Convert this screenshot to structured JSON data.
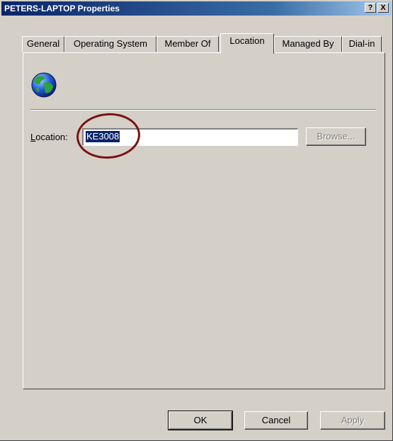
{
  "window": {
    "title": "PETERS-LAPTOP Properties",
    "help_label": "?",
    "close_label": "X"
  },
  "tabs": [
    {
      "label": "General"
    },
    {
      "label": "Operating System"
    },
    {
      "label": "Member Of"
    },
    {
      "label": "Location",
      "active": true
    },
    {
      "label": "Managed By"
    },
    {
      "label": "Dial-in"
    }
  ],
  "location": {
    "icon": "globe-icon",
    "label": "Location:",
    "value": "KE3008",
    "browse_label": "Browse..."
  },
  "footer": {
    "ok_label": "OK",
    "cancel_label": "Cancel",
    "apply_label": "Apply"
  },
  "colors": {
    "titlebar_start": "#0a246a",
    "face": "#d4d0c8",
    "highlight": "#0a246a",
    "annotation_circle": "#7a1313"
  }
}
